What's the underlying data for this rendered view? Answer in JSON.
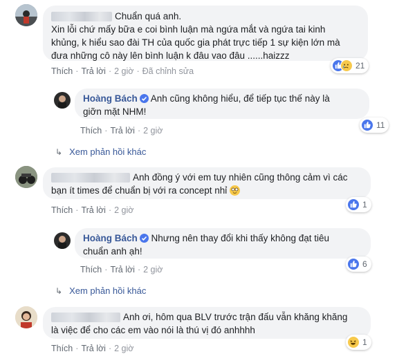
{
  "comments": [
    {
      "text": "Chuẩn quá anh.\nXin lỗi chứ mấy bữa e coi bình luận mà ngứa mắt và ngứa tai kinh khủng, k hiểu sao đài TH của quốc gia phát trực tiếp 1 sự kiện lớn mà đưa những cô này lên bình luận k đâu vao đâu ......haizzz",
      "line1": "Chuẩn quá anh.",
      "line2": "Xin lỗi chứ mấy bữa e coi bình luận mà ngứa mắt và ngứa tai kinh",
      "line3": "khủng, k hiểu sao đài TH của quốc gia phát trực tiếp 1 sự kiện lớn mà",
      "line4": "đưa những cô này lên bình luận k đâu vao đâu ......haizzz",
      "like": "Thích",
      "reply": "Trả lời",
      "time": "2 giờ",
      "edited": "Đã chỉnh sửa",
      "reactions": "21",
      "reply_item": {
        "author": "Hoàng Bách",
        "line1": "Anh cũng không hiểu, để tiếp tục thế này là",
        "line2": "giỡn mặt NHM!",
        "like": "Thích",
        "reply": "Trả lời",
        "time": "2 giờ",
        "reactions": "11"
      },
      "more_replies": "Xem phản hồi khác"
    },
    {
      "line1": "Anh đồng ý với em tuy nhiên cũng thông cảm vì các",
      "line2": "bạn ít times để chuẩn bị với ra concept nhỉ",
      "like": "Thích",
      "reply": "Trả lời",
      "time": "2 giờ",
      "reactions": "1",
      "reply_item": {
        "author": "Hoàng Bách",
        "line1": "Nhưng nên thay đổi khi thấy không đạt tiêu",
        "line2": "chuẩn anh ạh!",
        "like": "Thích",
        "reply": "Trả lời",
        "time": "2 giờ",
        "reactions": "6"
      },
      "more_replies": "Xem phản hồi khác"
    },
    {
      "line1": "Anh ơi, hôm qua BLV trước trận đấu vẫn khăng khăng",
      "line2": "là việc để cho các em vào nói là thú vị đó anhhhh",
      "like": "Thích",
      "reply": "Trả lời",
      "time": "2 giờ",
      "reactions": "1"
    }
  ],
  "colors": {
    "link": "#385898",
    "like": "#4a76ec",
    "bubble": "#f2f3f5",
    "meta": "#90949c"
  }
}
